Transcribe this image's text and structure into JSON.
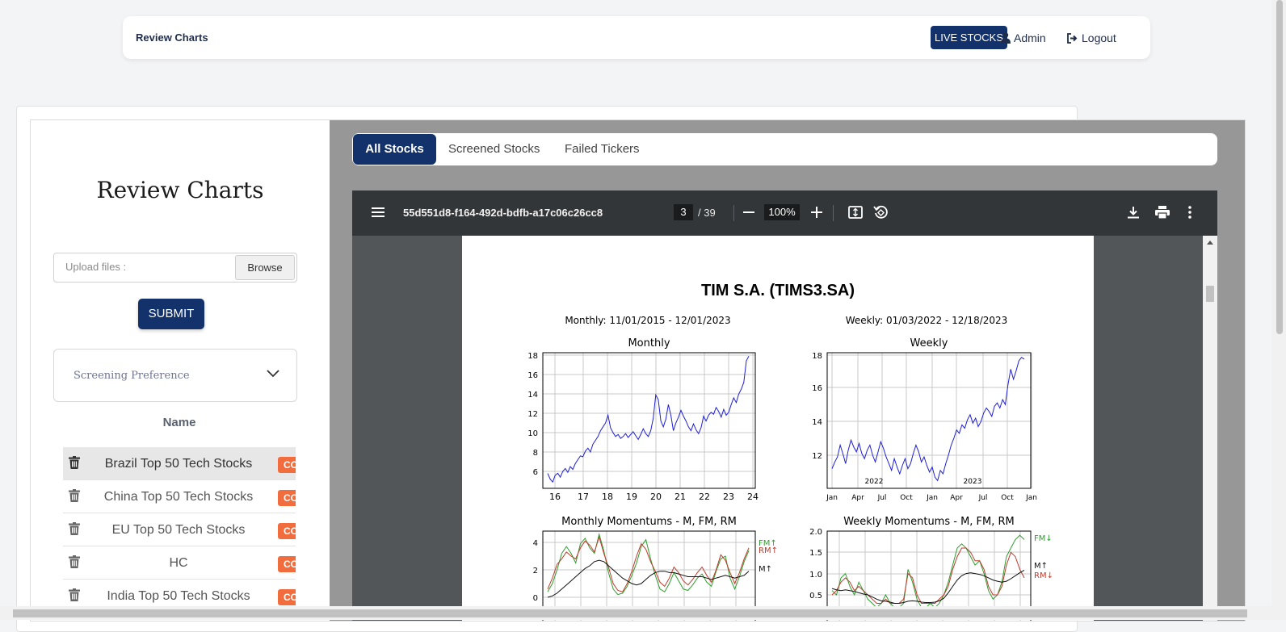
{
  "nav": {
    "brand": "Review Charts",
    "live_stocks": "LIVE STOCKS",
    "admin": "Admin",
    "logout": "Logout"
  },
  "sidebar": {
    "title": "Review Charts",
    "upload_placeholder": "Upload files :",
    "browse": "Browse",
    "submit": "SUBMIT",
    "screening_preference": "Screening Preference",
    "table_header": "Name",
    "rows": [
      {
        "name": "Brazil Top 50 Tech Stocks",
        "badge": "CO"
      },
      {
        "name": "China Top 50 Tech Stocks",
        "badge": "CO"
      },
      {
        "name": "EU Top 50 Tech Stocks",
        "badge": "CO"
      },
      {
        "name": "HC",
        "badge": "CO"
      },
      {
        "name": "India Top 50 Tech Stocks",
        "badge": "CO"
      }
    ]
  },
  "tabs": [
    "All Stocks",
    "Screened Stocks",
    "Failed Tickers"
  ],
  "pdf": {
    "filename": "55d551d8-f164-492d-bdfb-a17c06c26cc8",
    "page": "3",
    "total": "/ 39",
    "zoom": "100%",
    "doc_title": "TIM S.A. (TIMS3.SA)",
    "monthly_range": "Monthly: 11/01/2015 - 12/01/2023",
    "weekly_range": "Weekly: 01/03/2022 - 12/18/2023"
  },
  "chart_data": [
    {
      "type": "line",
      "title": "Monthly",
      "x_ticks": [
        "16",
        "17",
        "18",
        "19",
        "20",
        "21",
        "22",
        "23",
        "24"
      ],
      "y_ticks": [
        "6",
        "8",
        "10",
        "12",
        "14",
        "16",
        "18"
      ],
      "ylim": [
        4.5,
        18.5
      ],
      "series": [
        {
          "values": [
            5.8,
            5.2,
            4.9,
            5.6,
            5.8,
            5.4,
            6.0,
            6.3,
            5.9,
            6.5,
            6.2,
            6.8,
            7.2,
            7.6,
            7.5,
            8.1,
            8.4,
            8.0,
            8.8,
            9.2,
            9.6,
            10.2,
            10.6,
            11.0,
            11.8,
            10.5,
            10.0,
            9.6,
            9.8,
            9.4,
            9.6,
            9.9,
            9.5,
            9.8,
            10.1,
            9.7,
            9.3,
            9.8,
            10.4,
            9.9,
            9.6,
            10.2,
            11.5,
            13.9,
            13.4,
            11.2,
            10.6,
            11.4,
            12.9,
            11.8,
            10.2,
            11.0,
            11.6,
            12.3,
            11.7,
            11.2,
            10.6,
            10.2,
            10.9,
            10.3,
            9.9,
            10.5,
            11.7,
            11.2,
            11.8,
            12.1,
            11.9,
            12.6,
            12.2,
            11.6,
            12.4,
            11.8,
            12.1,
            12.9,
            13.6,
            13.1,
            14.0,
            14.5,
            15.2,
            17.4,
            17.9
          ]
        }
      ]
    },
    {
      "type": "line",
      "title": "Weekly",
      "x_ticks": [
        "Jan",
        "Apr",
        "Jul",
        "Oct",
        "Jan",
        "Apr",
        "Jul",
        "Oct",
        "Jan"
      ],
      "year_labels": [
        "2022",
        "2023"
      ],
      "y_ticks": [
        "12",
        "14",
        "16",
        "18"
      ],
      "ylim": [
        10.3,
        18.2
      ],
      "series": [
        {
          "values": [
            11.2,
            11.6,
            11.9,
            12.6,
            12.1,
            11.5,
            12.3,
            12.9,
            12.5,
            12.2,
            12.7,
            12.1,
            11.8,
            12.3,
            12.6,
            12.0,
            11.6,
            12.2,
            12.8,
            12.4,
            11.9,
            11.5,
            11.1,
            11.8,
            11.3,
            10.9,
            11.4,
            11.8,
            11.2,
            11.5,
            12.1,
            12.6,
            12.2,
            11.6,
            11.9,
            11.4,
            11.0,
            11.3,
            10.7,
            10.5,
            11.1,
            10.9,
            11.5,
            12.0,
            12.6,
            13.0,
            13.5,
            13.3,
            13.8,
            13.6,
            14.1,
            14.4,
            13.9,
            14.2,
            13.7,
            14.0,
            14.5,
            14.8,
            14.6,
            14.3,
            14.9,
            15.1,
            14.8,
            15.3,
            15.0,
            16.2,
            17.1,
            16.5,
            17.0,
            17.6,
            17.8,
            17.7
          ]
        }
      ]
    },
    {
      "type": "line",
      "title": "Monthly Momentums - M, FM, RM",
      "y_ticks": [
        "0",
        "2",
        "4"
      ],
      "ylim": [
        0,
        4.5
      ],
      "legend": [
        "FM↑",
        "RM↑",
        "M↑"
      ],
      "series": [
        {
          "name": "FM",
          "color": "#2e9e2e",
          "values": [
            0.4,
            1.0,
            2.0,
            3.2,
            3.7,
            3.2,
            2.5,
            3.9,
            4.3,
            3.6,
            3.2,
            4.6,
            3.4,
            1.8,
            0.6,
            0.2,
            0.3,
            0.8,
            1.6,
            2.5,
            3.7,
            4.2,
            2.8,
            1.6,
            0.6,
            0.4,
            1.0,
            1.8,
            1.2,
            0.6,
            0.5,
            0.9,
            1.4,
            1.7,
            1.1,
            0.8,
            1.9,
            2.8,
            3.0,
            1.4,
            0.6,
            1.5,
            2.6,
            3.4
          ]
        },
        {
          "name": "RM",
          "color": "#c0392b",
          "values": [
            0.6,
            1.4,
            2.4,
            2.8,
            3.3,
            3.0,
            2.8,
            3.6,
            4.1,
            3.8,
            3.3,
            4.4,
            3.2,
            2.2,
            1.0,
            0.5,
            0.4,
            1.0,
            1.9,
            3.0,
            3.9,
            3.5,
            2.6,
            1.9,
            1.1,
            0.8,
            1.4,
            2.2,
            1.8,
            1.2,
            0.9,
            1.3,
            1.8,
            2.2,
            1.6,
            1.1,
            2.0,
            3.1,
            2.7,
            1.8,
            1.0,
            1.8,
            2.8,
            3.6
          ]
        },
        {
          "name": "M",
          "color": "#111111",
          "values": [
            0.0,
            0.1,
            0.3,
            0.6,
            0.9,
            1.2,
            1.5,
            1.8,
            2.1,
            2.3,
            2.6,
            2.7,
            2.6,
            2.3,
            2.0,
            1.7,
            1.4,
            1.2,
            1.0,
            0.9,
            1.0,
            1.3,
            1.6,
            1.8,
            1.9,
            1.9,
            1.8,
            1.8,
            1.7,
            1.6,
            1.5,
            1.5,
            1.5,
            1.5,
            1.4,
            1.3,
            1.4,
            1.5,
            1.6,
            1.5,
            1.4,
            1.5,
            1.6,
            1.9
          ]
        }
      ]
    },
    {
      "type": "line",
      "title": "Weekly Momentums - M, FM, RM",
      "y_ticks": [
        "0.5",
        "1.0",
        "1.5",
        "2.0"
      ],
      "ylim": [
        0.3,
        2.0
      ],
      "legend": [
        "FM↓",
        "M↑",
        "RM↓"
      ],
      "series": [
        {
          "name": "FM",
          "color": "#2e9e2e",
          "values": [
            0.6,
            0.5,
            0.9,
            1.0,
            0.7,
            0.5,
            0.8,
            0.6,
            0.4,
            0.3,
            0.2,
            0.3,
            0.5,
            0.3,
            0.2,
            0.2,
            0.3,
            1.1,
            0.8,
            0.4,
            0.2,
            0.2,
            0.3,
            0.2,
            0.3,
            0.5,
            0.8,
            1.2,
            1.6,
            1.7,
            1.6,
            1.4,
            1.2,
            1.3,
            1.0,
            0.6,
            0.4,
            0.5,
            0.8,
            1.4,
            1.6,
            1.8,
            1.9,
            1.8
          ]
        },
        {
          "name": "RM",
          "color": "#c0392b",
          "values": [
            0.5,
            0.6,
            0.8,
            0.9,
            0.8,
            0.6,
            0.7,
            0.6,
            0.5,
            0.4,
            0.3,
            0.3,
            0.4,
            0.3,
            0.3,
            0.3,
            0.4,
            1.0,
            0.9,
            0.5,
            0.3,
            0.3,
            0.3,
            0.3,
            0.4,
            0.5,
            0.7,
            1.1,
            1.4,
            1.6,
            1.6,
            1.5,
            1.3,
            1.3,
            1.1,
            0.7,
            0.5,
            0.5,
            0.7,
            1.2,
            1.5,
            1.4,
            1.1,
            0.9
          ]
        },
        {
          "name": "M",
          "color": "#111111",
          "values": [
            0.65,
            0.62,
            0.6,
            0.62,
            0.6,
            0.58,
            0.55,
            0.52,
            0.5,
            0.45,
            0.4,
            0.36,
            0.35,
            0.33,
            0.3,
            0.3,
            0.32,
            0.35,
            0.36,
            0.35,
            0.33,
            0.32,
            0.32,
            0.33,
            0.36,
            0.42,
            0.55,
            0.7,
            0.85,
            0.95,
            1.0,
            1.02,
            1.0,
            0.98,
            0.95,
            0.9,
            0.85,
            0.82,
            0.8,
            0.82,
            0.88,
            0.95,
            1.02,
            1.08
          ]
        }
      ]
    }
  ]
}
